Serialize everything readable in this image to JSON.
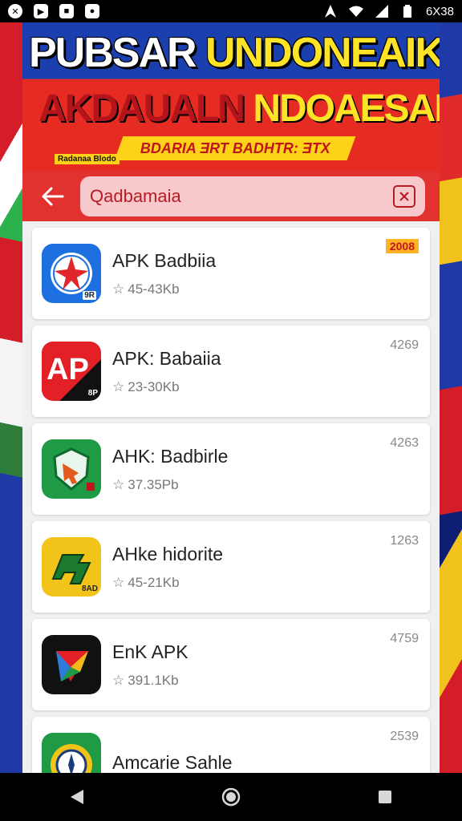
{
  "status_bar": {
    "time": "6X38"
  },
  "banner": {
    "title_white": "PUBSAR ",
    "title_yellow": "UNDONEAIK",
    "subtitle_red": "AKDAUALN ",
    "subtitle_yellow": "NDOAESAI.",
    "strip_text": "BDARIA ƎRT BADHTR: ƎTX",
    "tag": "Radanaa Blodo"
  },
  "search": {
    "value": "Qadbamaia"
  },
  "apps": [
    {
      "name": "APK Badbiia",
      "meta": "45-43Kb",
      "corner": "2008",
      "corner_type": "badge",
      "icon": "compass-red-star-icon",
      "icon_tag": "9R"
    },
    {
      "name": "APK: Babaiia",
      "meta": "23-30Kb",
      "corner": "4269",
      "corner_type": "num",
      "icon": "ap-logo-icon",
      "icon_text": "AP",
      "icon_tag": "8P"
    },
    {
      "name": "AHK: Badbirle",
      "meta": "37.35Pb",
      "corner": "4263",
      "corner_type": "num",
      "icon": "shield-arrow-icon"
    },
    {
      "name": "AHke hidorite",
      "meta": "45-21Kb",
      "corner": "1263",
      "corner_type": "num",
      "icon": "yellow-arrow-icon",
      "icon_tag": "8AD"
    },
    {
      "name": "EnK APK",
      "meta": "391.1Kb",
      "corner": "4759",
      "corner_type": "num",
      "icon": "play-arrow-icon"
    },
    {
      "name": "Amcarie Sahle",
      "meta": "",
      "corner": "2539",
      "corner_type": "num",
      "icon": "gear-compass-icon"
    }
  ],
  "colors": {
    "accent_red": "#e2322f",
    "search_bg": "#f8c9cc",
    "banner_yellow": "#ffe326"
  }
}
